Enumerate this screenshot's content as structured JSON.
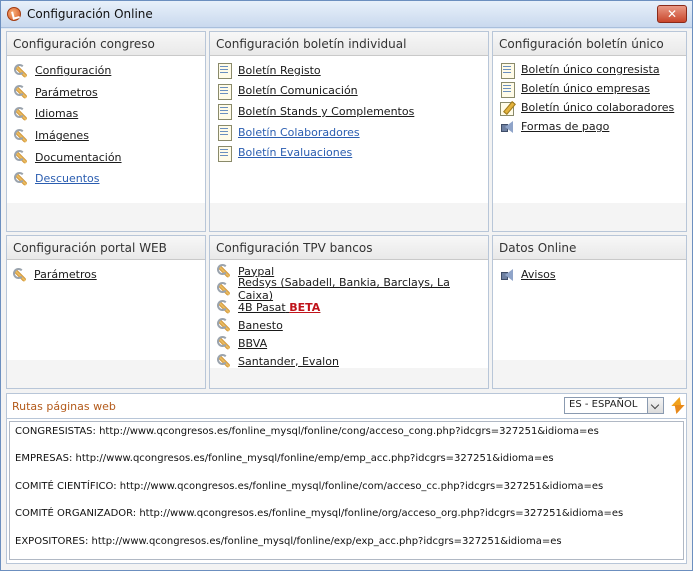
{
  "window": {
    "title": "Configuración Online",
    "close_label": "✕"
  },
  "panels": {
    "congreso": {
      "title": "Configuración congreso",
      "items": [
        {
          "label": "Configuración",
          "icon": "wrench-icon"
        },
        {
          "label": "Parámetros",
          "icon": "wrench-icon"
        },
        {
          "label": "Idiomas",
          "icon": "wrench-icon"
        },
        {
          "label": "Imágenes",
          "icon": "wrench-icon"
        },
        {
          "label": "Documentación",
          "icon": "wrench-icon"
        },
        {
          "label": "Descuentos",
          "icon": "wrench-icon"
        }
      ]
    },
    "boletin_individual": {
      "title": "Configuración boletín individual",
      "items": [
        {
          "label": "Boletín Registo",
          "icon": "document-icon"
        },
        {
          "label": "Boletín Comunicación",
          "icon": "document-icon"
        },
        {
          "label": "Boletín Stands y Complementos",
          "icon": "document-icon"
        },
        {
          "label": "Boletín Colaboradores",
          "icon": "document-icon"
        },
        {
          "label": "Boletín Evaluaciones",
          "icon": "document-icon"
        }
      ]
    },
    "boletin_unico": {
      "title": "Configuración boletín único",
      "items": [
        {
          "label": "Boletín único congresista",
          "icon": "document-icon"
        },
        {
          "label": "Boletín único empresas",
          "icon": "document-icon"
        },
        {
          "label": "Boletín único colaboradores",
          "icon": "document-edit-icon"
        },
        {
          "label": "Formas de pago",
          "icon": "speaker-icon"
        }
      ]
    },
    "portal_web": {
      "title": "Configuración portal WEB",
      "items": [
        {
          "label": "Parámetros",
          "icon": "wrench-icon"
        }
      ]
    },
    "tpv": {
      "title": "Configuración TPV bancos",
      "items": [
        {
          "label": "Paypal",
          "icon": "wrench-icon"
        },
        {
          "label": "Redsys (Sabadell, Bankia, Barclays, La Caixa)",
          "icon": "wrench-icon"
        },
        {
          "label": "4B Pasat",
          "badge": "BETA",
          "icon": "wrench-icon"
        },
        {
          "label": "Banesto",
          "icon": "wrench-icon"
        },
        {
          "label": "BBVA",
          "icon": "wrench-icon"
        },
        {
          "label": "Santander, Evalon",
          "icon": "wrench-icon"
        }
      ]
    },
    "datos_online": {
      "title": "Datos Online",
      "items": [
        {
          "label": "Avisos",
          "icon": "speaker-icon"
        }
      ]
    }
  },
  "routes": {
    "title": "Rutas páginas web",
    "language": "ES - ESPAÑOL",
    "lines": [
      "CONGRESISTAS: http://www.qcongresos.es/fonline_mysql/fonline/cong/acceso_cong.php?idcgrs=327251&idioma=es",
      "EMPRESAS: http://www.qcongresos.es/fonline_mysql/fonline/emp/emp_acc.php?idcgrs=327251&idioma=es",
      "COMITÉ CIENTÍFICO: http://www.qcongresos.es/fonline_mysql/fonline/com/acceso_cc.php?idcgrs=327251&idioma=es",
      "COMITÉ ORGANIZADOR: http://www.qcongresos.es/fonline_mysql/fonline/org/acceso_org.php?idcgrs=327251&idioma=es",
      "EXPOSITORES: http://www.qcongresos.es/fonline_mysql/fonline/exp/exp_acc.php?idcgrs=327251&idioma=es"
    ]
  },
  "colors": {
    "accent": "#2a5db0",
    "beta": "#c0141b",
    "routes_title": "#b35a1a"
  }
}
